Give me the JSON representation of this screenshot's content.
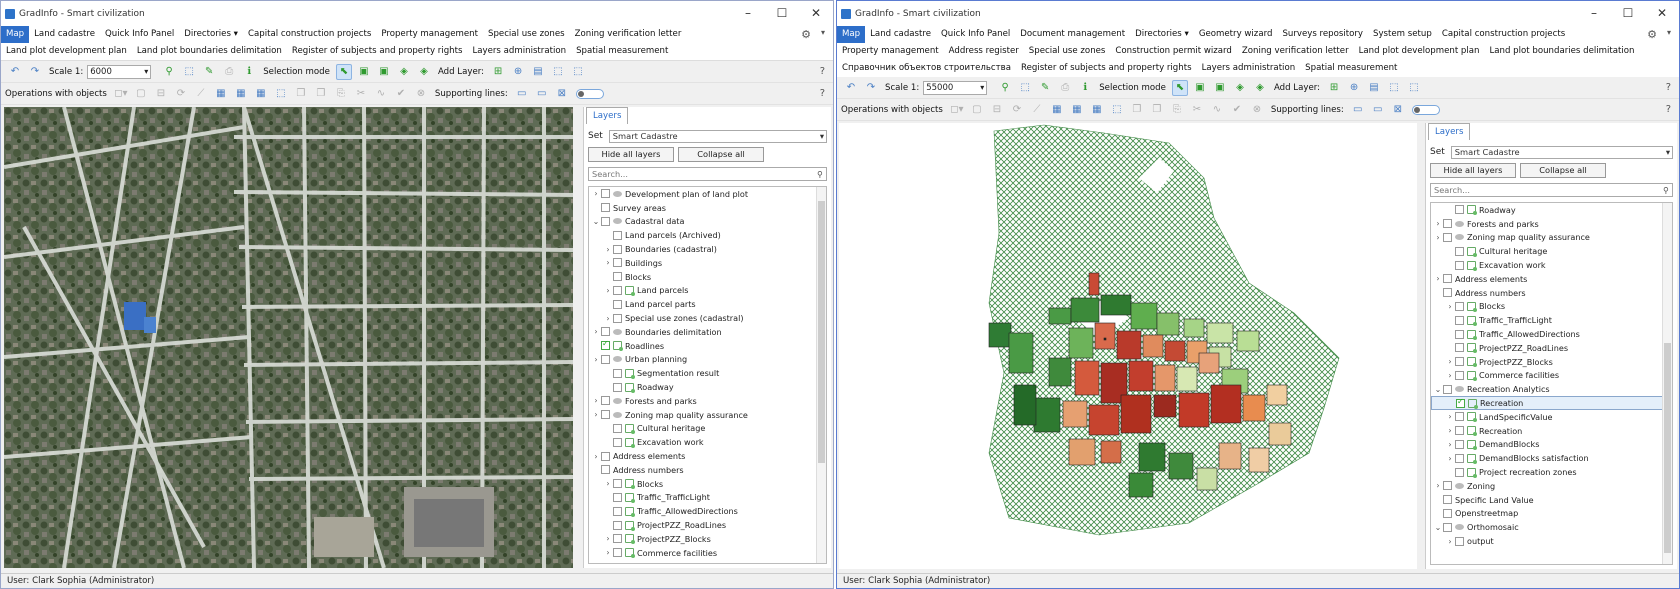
{
  "win1": {
    "title": "GradInfo - Smart civilization",
    "menu": [
      "Map",
      "Land cadastre",
      "Quick Info Panel",
      "Directories ▾",
      "Capital construction projects",
      "Property management",
      "Special use zones",
      "Zoning verification letter",
      "Land plot development plan",
      "Land plot boundaries delimitation",
      "Register of subjects and property rights",
      "Layers administration",
      "Spatial measurement"
    ],
    "toolbar1": {
      "scale_label": "Scale 1:",
      "scale_value": "6000",
      "selection_mode": "Selection mode",
      "add_layer": "Add Layer:"
    },
    "toolbar2": {
      "ops_label": "Operations with objects",
      "supporting_lines": "Supporting lines:"
    },
    "panel": {
      "tab": "Layers",
      "set_label": "Set",
      "set_value": "Smart Cadastre",
      "hide_all": "Hide all layers",
      "collapse_all": "Collapse all",
      "search_placeholder": "Search...",
      "rows": [
        {
          "t": "Development plan of land plot",
          "l": 0,
          "a": "›",
          "k": "grp"
        },
        {
          "t": "Survey areas",
          "l": 0,
          "a": "",
          "k": "cb"
        },
        {
          "t": "Cadastral data",
          "l": 0,
          "a": "⌄",
          "k": "grp"
        },
        {
          "t": "Land parcels (Archived)",
          "l": 1,
          "a": "",
          "k": "cb"
        },
        {
          "t": "Boundaries (cadastral)",
          "l": 1,
          "a": "›",
          "k": "cb"
        },
        {
          "t": "Buildings",
          "l": 1,
          "a": "›",
          "k": "cb"
        },
        {
          "t": "Blocks",
          "l": 1,
          "a": "",
          "k": "cb"
        },
        {
          "t": "Land parcels",
          "l": 1,
          "a": "›",
          "k": "lyr"
        },
        {
          "t": "Land parcel parts",
          "l": 1,
          "a": "",
          "k": "cb"
        },
        {
          "t": "Special use zones (cadastral)",
          "l": 1,
          "a": "›",
          "k": "cb"
        },
        {
          "t": "Boundaries delimitation",
          "l": 0,
          "a": "›",
          "k": "grp"
        },
        {
          "t": "Roadlines",
          "l": 0,
          "a": "",
          "k": "chk"
        },
        {
          "t": "Urban planning",
          "l": 0,
          "a": "›",
          "k": "grp"
        },
        {
          "t": "Segmentation result",
          "l": 1,
          "a": "",
          "k": "lyr"
        },
        {
          "t": "Roadway",
          "l": 1,
          "a": "",
          "k": "lyr"
        },
        {
          "t": "Forests and parks",
          "l": 0,
          "a": "›",
          "k": "grp"
        },
        {
          "t": "Zoning map quality assurance",
          "l": 0,
          "a": "›",
          "k": "grp"
        },
        {
          "t": "Cultural heritage",
          "l": 1,
          "a": "",
          "k": "lyr"
        },
        {
          "t": "Excavation work",
          "l": 1,
          "a": "",
          "k": "lyr"
        },
        {
          "t": "Address elements",
          "l": 0,
          "a": "›",
          "k": "cb"
        },
        {
          "t": "Address numbers",
          "l": 0,
          "a": "",
          "k": "cb"
        },
        {
          "t": "Blocks",
          "l": 1,
          "a": "›",
          "k": "lyr"
        },
        {
          "t": "Traffic_TrafficLight",
          "l": 1,
          "a": "",
          "k": "lyr"
        },
        {
          "t": "Traffic_AllowedDirections",
          "l": 1,
          "a": "",
          "k": "lyr"
        },
        {
          "t": "ProjectPZZ_RoadLines",
          "l": 1,
          "a": "",
          "k": "lyr"
        },
        {
          "t": "ProjectPZZ_Blocks",
          "l": 1,
          "a": "›",
          "k": "lyr"
        },
        {
          "t": "Commerce facilities",
          "l": 1,
          "a": "›",
          "k": "lyr"
        }
      ]
    },
    "status": "User: Clark Sophia  (Administrator)"
  },
  "win2": {
    "title": "GradInfo - Smart civilization",
    "menu": [
      "Map",
      "Land cadastre",
      "Quick Info Panel",
      "Document management",
      "Directories ▾",
      "Geometry wizard",
      "Surveys repository",
      "System setup",
      "Capital construction projects",
      "Property management",
      "Address register",
      "Special use zones",
      "Construction permit wizard",
      "Zoning verification letter",
      "Land plot development plan",
      "Land plot boundaries delimitation",
      "Справочник объектов строительства",
      "Register of subjects and property rights",
      "Layers administration",
      "Spatial measurement"
    ],
    "toolbar1": {
      "scale_label": "Scale 1:",
      "scale_value": "55000",
      "selection_mode": "Selection mode",
      "add_layer": "Add Layer:"
    },
    "toolbar2": {
      "ops_label": "Operations with objects",
      "supporting_lines": "Supporting lines:"
    },
    "panel": {
      "tab": "Layers",
      "set_label": "Set",
      "set_value": "Smart Cadastre",
      "hide_all": "Hide all layers",
      "collapse_all": "Collapse all",
      "search_placeholder": "Search...",
      "rows": [
        {
          "t": "Roadway",
          "l": 1,
          "a": "",
          "k": "lyr"
        },
        {
          "t": "Forests and parks",
          "l": 0,
          "a": "›",
          "k": "grp"
        },
        {
          "t": "Zoning map quality assurance",
          "l": 0,
          "a": "›",
          "k": "grp"
        },
        {
          "t": "Cultural heritage",
          "l": 1,
          "a": "",
          "k": "lyr"
        },
        {
          "t": "Excavation work",
          "l": 1,
          "a": "",
          "k": "lyr"
        },
        {
          "t": "Address elements",
          "l": 0,
          "a": "›",
          "k": "cb"
        },
        {
          "t": "Address numbers",
          "l": 0,
          "a": "",
          "k": "cb"
        },
        {
          "t": "Blocks",
          "l": 1,
          "a": "›",
          "k": "lyr"
        },
        {
          "t": "Traffic_TrafficLight",
          "l": 1,
          "a": "",
          "k": "lyr"
        },
        {
          "t": "Traffic_AllowedDirections",
          "l": 1,
          "a": "",
          "k": "lyr"
        },
        {
          "t": "ProjectPZZ_RoadLines",
          "l": 1,
          "a": "",
          "k": "lyr"
        },
        {
          "t": "ProjectPZZ_Blocks",
          "l": 1,
          "a": "›",
          "k": "lyr"
        },
        {
          "t": "Commerce facilities",
          "l": 1,
          "a": "›",
          "k": "lyr"
        },
        {
          "t": "Recreation Analytics",
          "l": 0,
          "a": "⌄",
          "k": "grp"
        },
        {
          "t": "Recreation",
          "l": 1,
          "a": "",
          "k": "chk",
          "hl": true
        },
        {
          "t": "LandSpecificValue",
          "l": 1,
          "a": "›",
          "k": "lyr"
        },
        {
          "t": "Recreation",
          "l": 1,
          "a": "›",
          "k": "lyr"
        },
        {
          "t": "DemandBlocks",
          "l": 1,
          "a": "›",
          "k": "lyr"
        },
        {
          "t": "DemandBlocks satisfaction",
          "l": 1,
          "a": "›",
          "k": "lyr"
        },
        {
          "t": "Project recreation zones",
          "l": 1,
          "a": "",
          "k": "lyr"
        },
        {
          "t": "Zoning",
          "l": 0,
          "a": "›",
          "k": "grp"
        },
        {
          "t": "Specific Land Value",
          "l": 0,
          "a": "",
          "k": "cb"
        },
        {
          "t": "Openstreetmap",
          "l": 0,
          "a": "",
          "k": "cb"
        },
        {
          "t": "Orthomosaic",
          "l": 0,
          "a": "⌄",
          "k": "grp"
        },
        {
          "t": "output",
          "l": 1,
          "a": "›",
          "k": "cb"
        }
      ]
    },
    "status": "User: Clark Sophia  (Administrator)"
  }
}
